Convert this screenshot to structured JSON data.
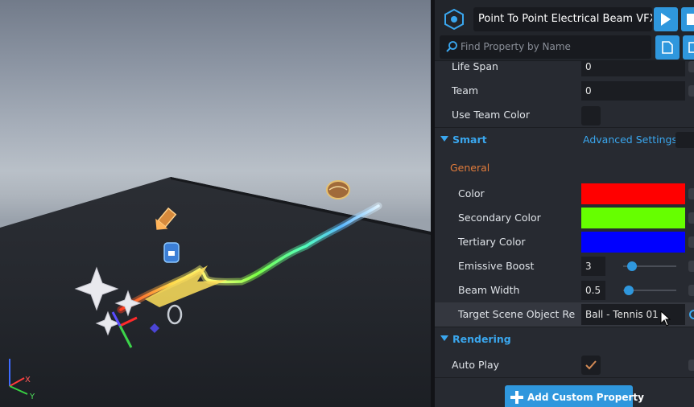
{
  "header": {
    "object_name": "Point To Point Electrical Beam VFX",
    "search_placeholder": "Find Property by Name"
  },
  "properties_top": {
    "life_span": {
      "label": "Life Span",
      "value": "0"
    },
    "team": {
      "label": "Team",
      "value": "0"
    },
    "use_team_color": {
      "label": "Use Team Color",
      "checked": false
    }
  },
  "smart": {
    "title": "Smart",
    "advanced_settings": "Advanced Settings",
    "general_label": "General",
    "color": {
      "label": "Color",
      "value": "#ff0000"
    },
    "secondary_color": {
      "label": "Secondary Color",
      "value": "#66ff00"
    },
    "tertiary_color": {
      "label": "Tertiary Color",
      "value": "#0000ff"
    },
    "emissive_boost": {
      "label": "Emissive Boost",
      "value": "3",
      "level": 0.1
    },
    "beam_width": {
      "label": "Beam Width",
      "value": "0.5",
      "level": 0.02
    },
    "target": {
      "label": "Target Scene Object Re",
      "value": "Ball - Tennis 01"
    }
  },
  "rendering": {
    "title": "Rendering",
    "auto_play": {
      "label": "Auto Play",
      "checked": true
    }
  },
  "footer": {
    "add_custom_property": "Add Custom Property"
  },
  "gizmo": {
    "x": "X",
    "y": "Y"
  },
  "colors": {
    "accent": "#2f97dd",
    "section_header": "#3aa7ef",
    "general": "#e07b3b",
    "panel": "#272a31"
  }
}
